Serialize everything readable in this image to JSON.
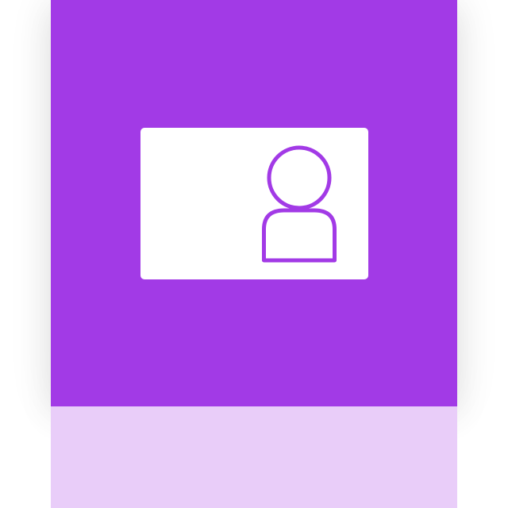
{
  "icon": {
    "name": "contact-card-icon",
    "tile_color": "#a23ae6",
    "card_color": "#ffffff",
    "glyph_color": "#a23ae6",
    "reflection_color": "#e9cdf9"
  }
}
